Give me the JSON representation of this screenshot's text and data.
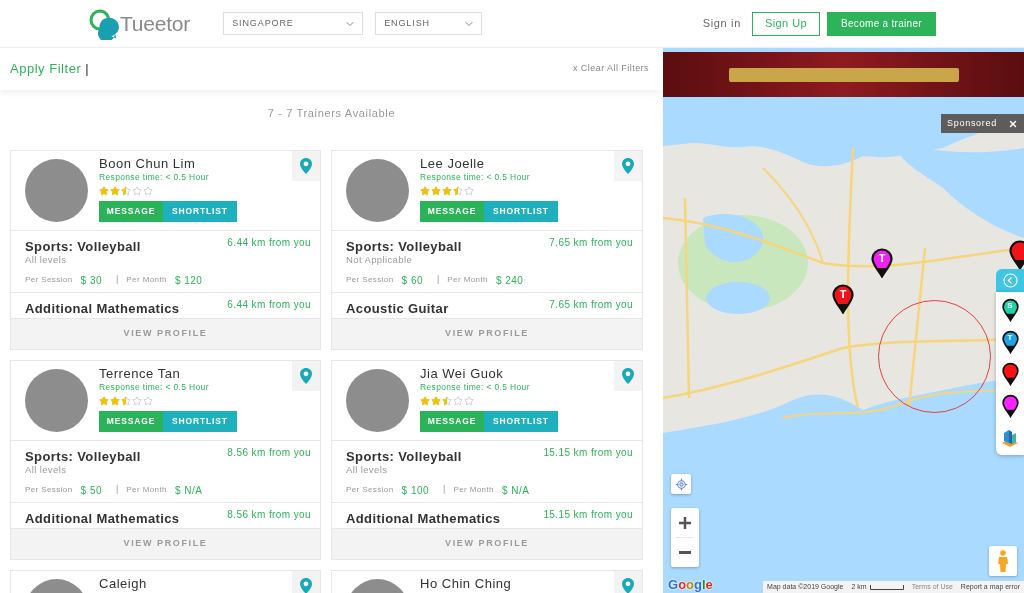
{
  "header": {
    "logo": "Tueetor",
    "country_select": "SINGAPORE",
    "language_select": "ENGLISH",
    "sign_in": "Sign in",
    "sign_up": "Sign Up",
    "become_trainer": "Become a trainer"
  },
  "filter_bar": {
    "apply_filter": "Apply Filter",
    "cursor": "|",
    "clear_all": "x Clear All Filters"
  },
  "results_count": "7 - 7 Trainers Available",
  "trainers": [
    {
      "name": "Boon Chun Lim",
      "response_time": "Response time: < 0.5 Hour",
      "stars": 2.5,
      "buttons": [
        {
          "label": "MESSAGE",
          "kind": "primary"
        },
        {
          "label": "SHORTLIST",
          "kind": "secondary"
        }
      ],
      "subjects": [
        {
          "title": "Sports: Volleyball",
          "distance": "6.44 km from you",
          "skill_level": "All levels",
          "prices": [
            {
              "label": "Per Session",
              "value": "$ 30"
            },
            {
              "label": "Per Month",
              "value": "$ 120"
            }
          ],
          "price_separator": "|"
        },
        {
          "title": "Additional Mathematics",
          "distance": "6.44 km from you"
        }
      ],
      "view_profile": "VIEW PROFILE"
    },
    {
      "name": "Lee Joelle",
      "response_time": "Response time: < 0.5 Hour",
      "stars": 3.5,
      "buttons": [
        {
          "label": "MESSAGE",
          "kind": "primary"
        },
        {
          "label": "SHORTLIST",
          "kind": "secondary"
        }
      ],
      "subjects": [
        {
          "title": "Sports: Volleyball",
          "distance": "7.65 km from you",
          "skill_level": "Not Applicable",
          "prices": [
            {
              "label": "Per Session",
              "value": "$ 60"
            },
            {
              "label": "Per Month",
              "value": "$ 240"
            }
          ],
          "price_separator": "|"
        },
        {
          "title": "Acoustic Guitar",
          "distance": "7.65 km from you"
        }
      ],
      "view_profile": "VIEW PROFILE"
    },
    {
      "name": "Terrence Tan",
      "response_time": "Response time: < 0.5 Hour",
      "stars": 2.5,
      "buttons": [
        {
          "label": "MESSAGE",
          "kind": "primary"
        },
        {
          "label": "SHORTLIST",
          "kind": "secondary"
        }
      ],
      "subjects": [
        {
          "title": "Sports: Volleyball",
          "distance": "8.56 km from you",
          "skill_level": "All levels",
          "prices": [
            {
              "label": "Per Session",
              "value": "$ 50"
            },
            {
              "label": "Per Month",
              "value": "$ N/A"
            }
          ],
          "price_separator": "|"
        },
        {
          "title": "Additional Mathematics",
          "distance": "8.56 km from you"
        }
      ],
      "view_profile": "VIEW PROFILE"
    },
    {
      "name": "Jia Wei Guok",
      "response_time": "Response time: < 0.5 Hour",
      "stars": 2.5,
      "buttons": [
        {
          "label": "MESSAGE",
          "kind": "primary"
        },
        {
          "label": "SHORTLIST",
          "kind": "secondary"
        }
      ],
      "subjects": [
        {
          "title": "Sports: Volleyball",
          "distance": "15.15 km from you",
          "skill_level": "All levels",
          "prices": [
            {
              "label": "Per Session",
              "value": "$ 100"
            },
            {
              "label": "Per Month",
              "value": "$ N/A"
            }
          ],
          "price_separator": "|"
        },
        {
          "title": "Additional Mathematics",
          "distance": "15.15 km from you"
        }
      ],
      "view_profile": "VIEW PROFILE"
    },
    {
      "name": "Caleigh"
    },
    {
      "name": "Ho Chin Ching"
    }
  ],
  "map": {
    "sponsored": "Sponsored",
    "markers": [
      {
        "letter": "T",
        "color": "#f020f0"
      },
      {
        "letter": "T",
        "color": "#f01418"
      },
      {
        "color": "#f01418"
      }
    ],
    "legend": [
      {
        "kind": "pin",
        "letter": "S",
        "color": "#1ed3a3"
      },
      {
        "kind": "pin",
        "letter": "T",
        "color": "#1ca4e6"
      },
      {
        "kind": "pin",
        "color": "#ff1111"
      },
      {
        "kind": "pin",
        "color": "#ff22ff"
      },
      {
        "kind": "building"
      }
    ],
    "logo": "Google",
    "attribution": {
      "map_data": "Map data ©2019 Google",
      "scale": "2 km",
      "terms": "Terms of Use",
      "report": "Report a map error"
    }
  }
}
